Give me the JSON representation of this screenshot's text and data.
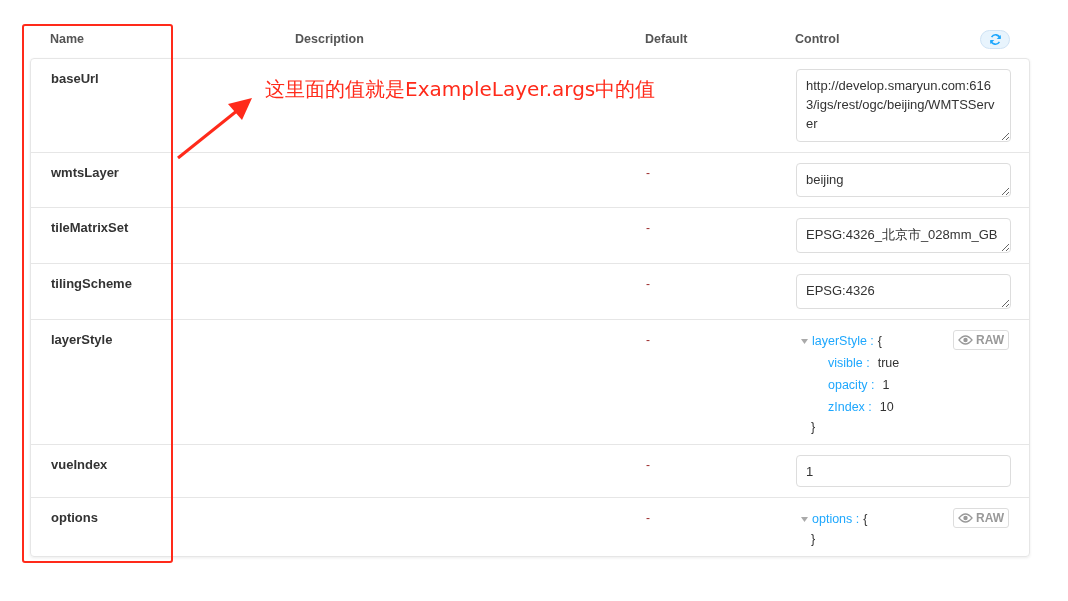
{
  "columns": [
    "Name",
    "Description",
    "Default",
    "Control"
  ],
  "rows": [
    {
      "name": "baseUrl",
      "default": "",
      "control": {
        "kind": "textarea",
        "value": "http://develop.smaryun.com:6163/igs/rest/ogc/beijing/WMTSServer"
      }
    },
    {
      "name": "wmtsLayer",
      "default": "-",
      "control": {
        "kind": "textarea",
        "value": "beijing"
      }
    },
    {
      "name": "tileMatrixSet",
      "default": "-",
      "control": {
        "kind": "textarea",
        "value": "EPSG:4326_北京市_028mm_GB"
      }
    },
    {
      "name": "tilingScheme",
      "default": "-",
      "control": {
        "kind": "textarea",
        "value": "EPSG:4326"
      }
    },
    {
      "name": "layerStyle",
      "default": "-",
      "control": {
        "kind": "object",
        "key": "layerStyle :",
        "open": "{",
        "close": "}",
        "expanded": true,
        "raw_label": "RAW",
        "fields": [
          {
            "key": "visible :",
            "value": "true"
          },
          {
            "key": "opacity :",
            "value": "1"
          },
          {
            "key": "zIndex :",
            "value": "10"
          }
        ]
      }
    },
    {
      "name": "vueIndex",
      "default": "-",
      "control": {
        "kind": "number",
        "value": "1"
      }
    },
    {
      "name": "options",
      "default": "-",
      "control": {
        "kind": "object",
        "key": "options :",
        "open": "{",
        "close": "}",
        "expanded": true,
        "raw_label": "RAW"
      }
    }
  ],
  "annotation": {
    "text": "这里面的值就是ExampleLayer.args中的值"
  }
}
